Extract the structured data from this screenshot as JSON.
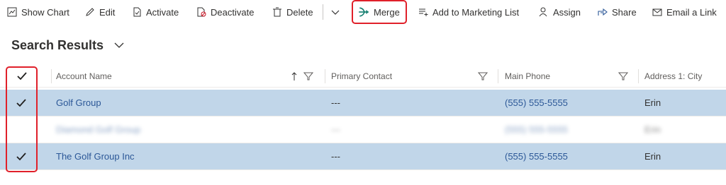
{
  "toolbar": {
    "show_chart": "Show Chart",
    "edit": "Edit",
    "activate": "Activate",
    "deactivate": "Deactivate",
    "delete": "Delete",
    "merge": "Merge",
    "add_marketing": "Add to Marketing List",
    "assign": "Assign",
    "share": "Share",
    "email_link": "Email a Link"
  },
  "view": {
    "title": "Search Results"
  },
  "grid": {
    "columns": [
      "Account Name",
      "Primary Contact",
      "Main Phone",
      "Address 1: City"
    ],
    "rows": [
      {
        "selected": true,
        "account": "Golf Group",
        "contact": "---",
        "phone": "(555) 555-5555",
        "city": "Erin"
      },
      {
        "selected": false,
        "account": "Diamond Golf Group",
        "contact": "---",
        "phone": "(555) 555-5555",
        "city": "Erin"
      },
      {
        "selected": true,
        "account": "The Golf Group Inc",
        "contact": "---",
        "phone": "(555) 555-5555",
        "city": "Erin"
      }
    ]
  },
  "colors": {
    "accent": "#2b5797",
    "selected_row": "#c1d6e9",
    "highlight": "#e0202a",
    "merge_icon": "#0f7b6c"
  }
}
